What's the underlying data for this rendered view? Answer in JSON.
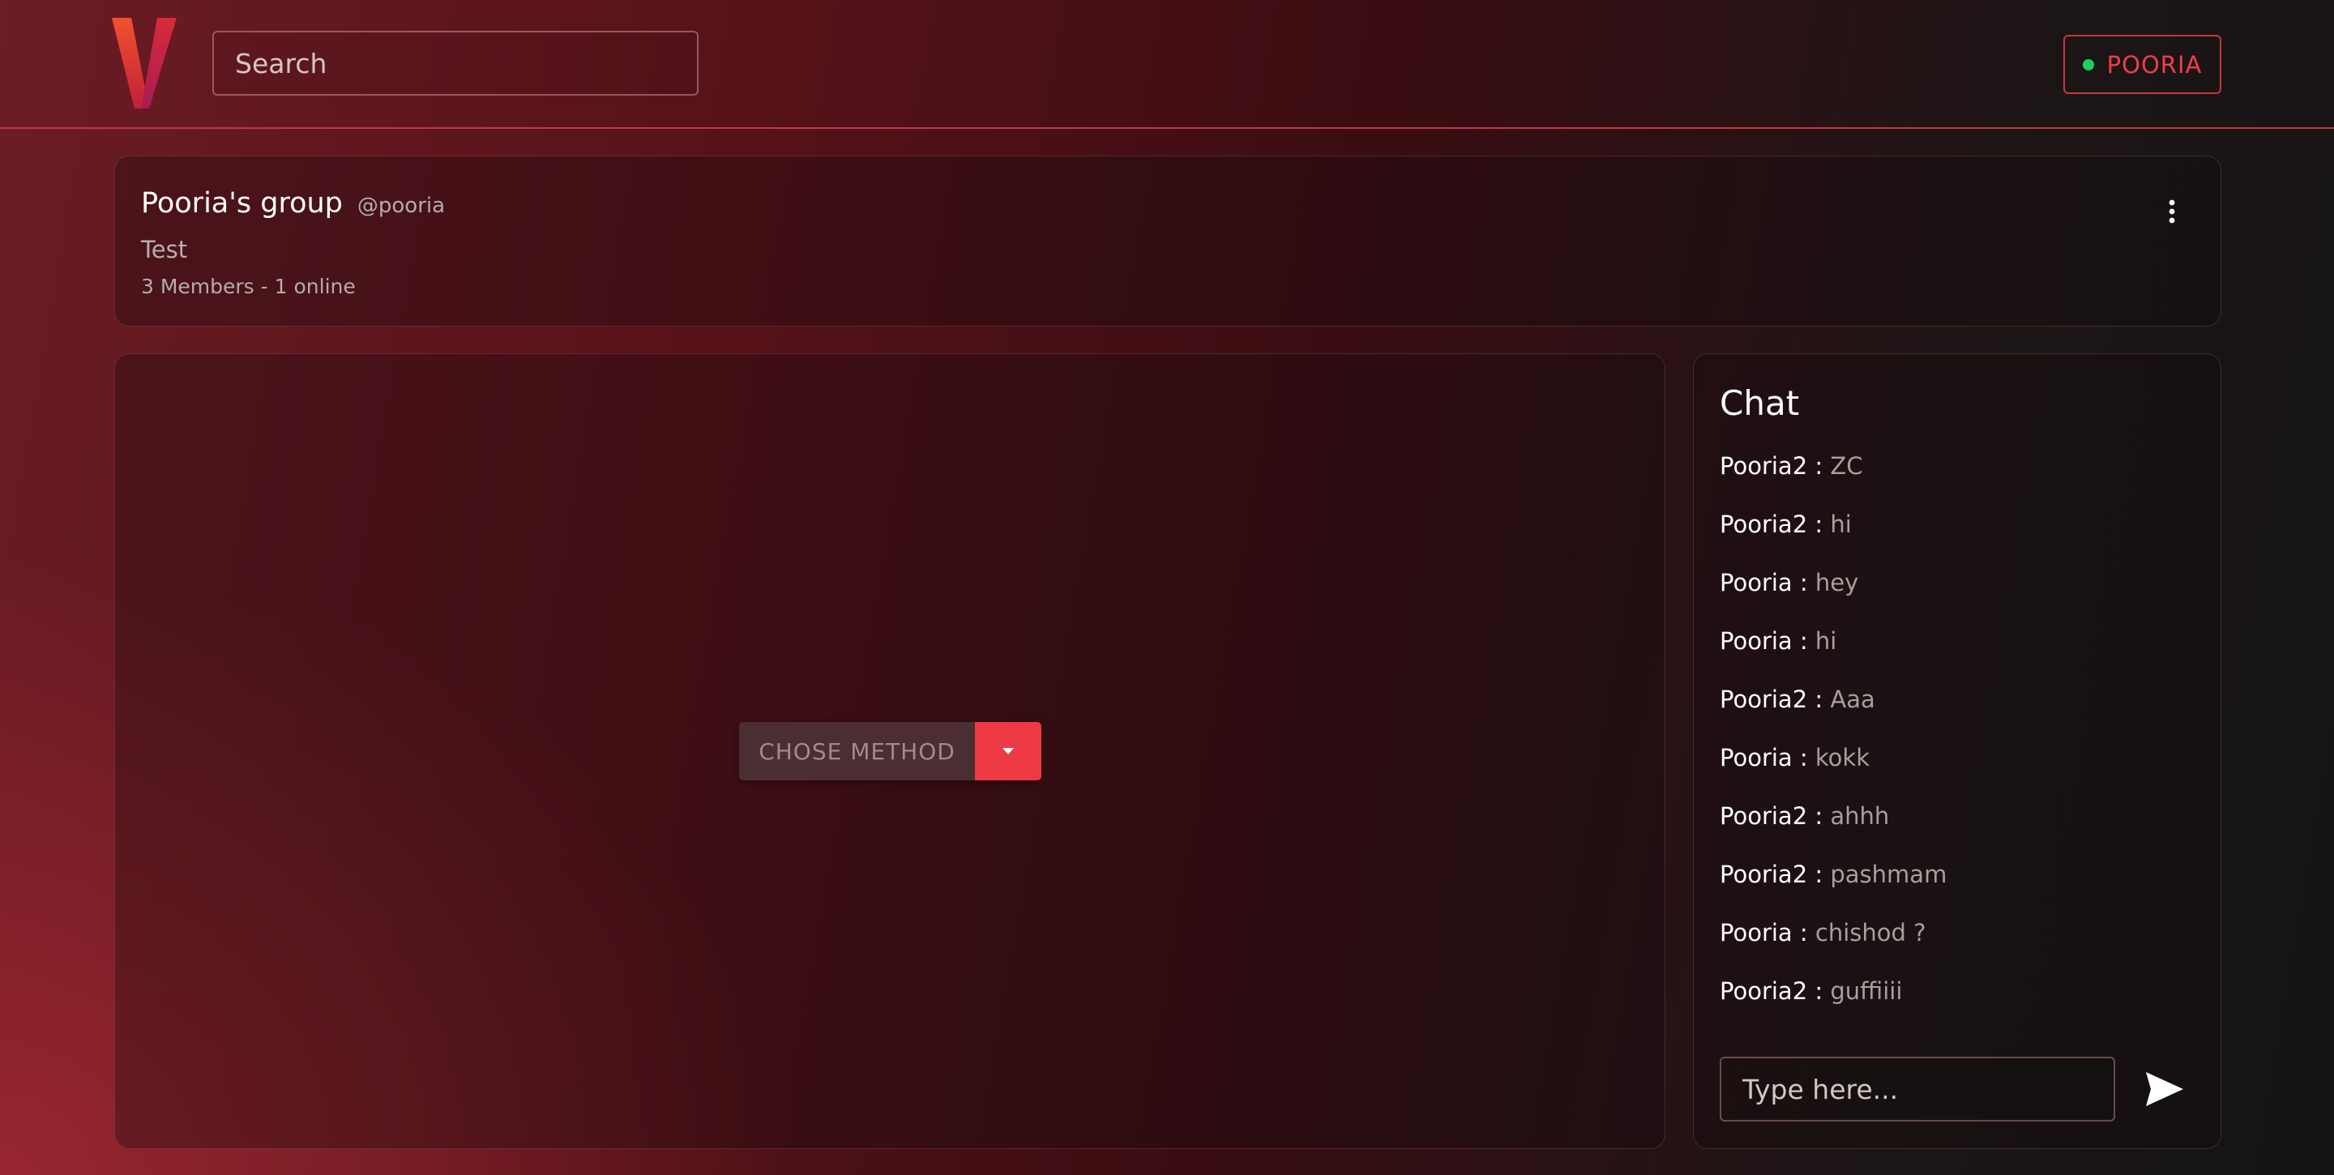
{
  "header": {
    "logo_letter": "V",
    "search_placeholder": "Search",
    "user_label": "POORIA",
    "status_color": "#1fcf5e",
    "accent_color": "#ee3a45"
  },
  "group": {
    "title": "Pooria's group",
    "handle": "@pooria",
    "description": "Test",
    "members": "3 Members - 1 online",
    "menu_icon": "more-vertical-icon"
  },
  "main": {
    "method_label": "CHOSE METHOD",
    "dropdown_icon": "caret-down-icon"
  },
  "chat": {
    "title": "Chat",
    "separator": " : ",
    "messages": [
      {
        "user": "Pooria2",
        "text": "ZC"
      },
      {
        "user": "Pooria2",
        "text": "hi"
      },
      {
        "user": "Pooria",
        "text": "hey"
      },
      {
        "user": "Pooria",
        "text": "hi"
      },
      {
        "user": "Pooria2",
        "text": "Aaa"
      },
      {
        "user": "Pooria",
        "text": "kokk"
      },
      {
        "user": "Pooria2",
        "text": "ahhh"
      },
      {
        "user": "Pooria2",
        "text": "pashmam"
      },
      {
        "user": "Pooria",
        "text": "chishod ?"
      },
      {
        "user": "Pooria2",
        "text": "guffiiii"
      }
    ],
    "input_placeholder": "Type here...",
    "send_icon": "send-icon"
  }
}
